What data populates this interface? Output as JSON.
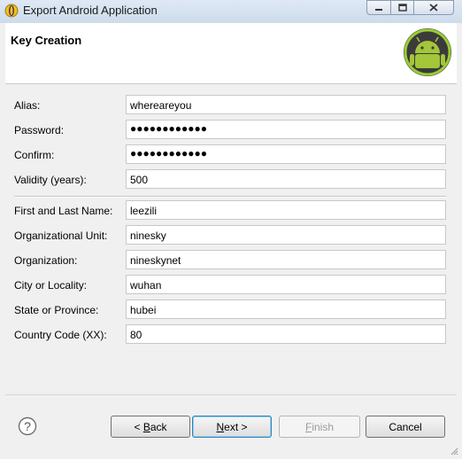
{
  "window": {
    "title": "Export Android Application"
  },
  "banner": {
    "title": "Key Creation"
  },
  "form": {
    "alias": {
      "label": "Alias:",
      "value": "whereareyou"
    },
    "password": {
      "label": "Password:",
      "value": "●●●●●●●●●●●●"
    },
    "confirm": {
      "label": "Confirm:",
      "value": "●●●●●●●●●●●●"
    },
    "validity": {
      "label": "Validity (years):",
      "value": "500"
    },
    "name": {
      "label": "First and Last Name:",
      "value": "leezili"
    },
    "unit": {
      "label": "Organizational Unit:",
      "value": "ninesky"
    },
    "org": {
      "label": "Organization:",
      "value": "nineskynet"
    },
    "city": {
      "label": "City or Locality:",
      "value": "wuhan"
    },
    "state": {
      "label": "State or Province:",
      "value": "hubei"
    },
    "country": {
      "label": "Country Code (XX):",
      "value": "80"
    }
  },
  "buttons": {
    "back_prefix": "< ",
    "back_mnemonic": "B",
    "back_rest": "ack",
    "next_mnemonic": "N",
    "next_rest": "ext >",
    "finish_mnemonic": "F",
    "finish_rest": "inish",
    "cancel": "Cancel"
  }
}
